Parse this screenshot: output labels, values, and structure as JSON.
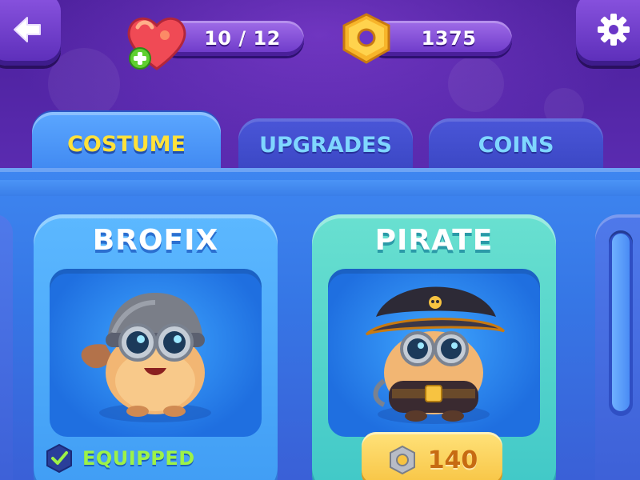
{
  "lives": {
    "value": "10 / 12"
  },
  "currency": {
    "value": "1375"
  },
  "tabs": [
    {
      "label": "COSTUME",
      "active": true
    },
    {
      "label": "UPGRADES",
      "active": false
    },
    {
      "label": "COINS",
      "active": false
    }
  ],
  "cards": [
    {
      "title": "BROFIX",
      "status": "EQUIPPED"
    },
    {
      "title": "PIRATE",
      "price": "140"
    }
  ],
  "colors": {
    "active_tab_text": "#ffe13a",
    "inactive_tab_text": "#7fd6ff",
    "equipped_text": "#9df247",
    "price_text": "#c76b12"
  },
  "icons": [
    "back-arrow-icon",
    "gear-icon",
    "heart-icon",
    "plus-icon",
    "nut-coin-icon",
    "checkmark-icon",
    "skull-icon"
  ]
}
